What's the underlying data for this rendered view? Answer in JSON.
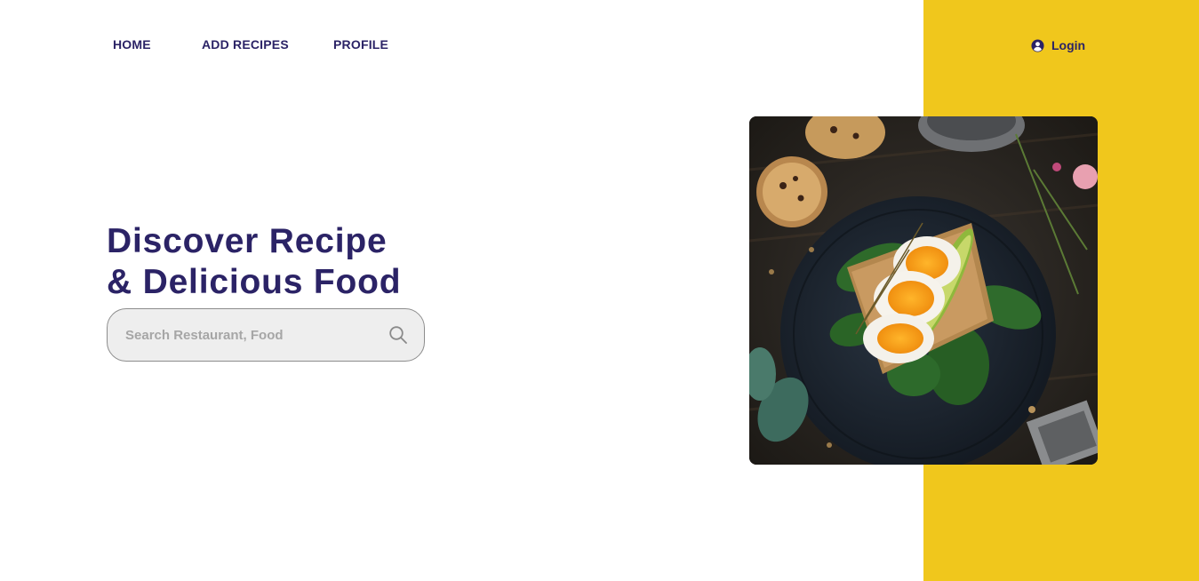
{
  "nav": {
    "items": [
      {
        "label": "HOME"
      },
      {
        "label": "ADD RECIPES"
      },
      {
        "label": "PROFILE"
      }
    ]
  },
  "auth": {
    "login_label": "Login",
    "icon": "user-circle-icon"
  },
  "hero": {
    "headline_line1": "Discover Recipe",
    "headline_line2": "& Delicious Food"
  },
  "search": {
    "placeholder": "Search Restaurant, Food",
    "value": "",
    "icon": "search-icon"
  },
  "colors": {
    "accent_yellow": "#F0C71C",
    "text_primary": "#2B2366",
    "search_bg": "#EEEEEE"
  }
}
